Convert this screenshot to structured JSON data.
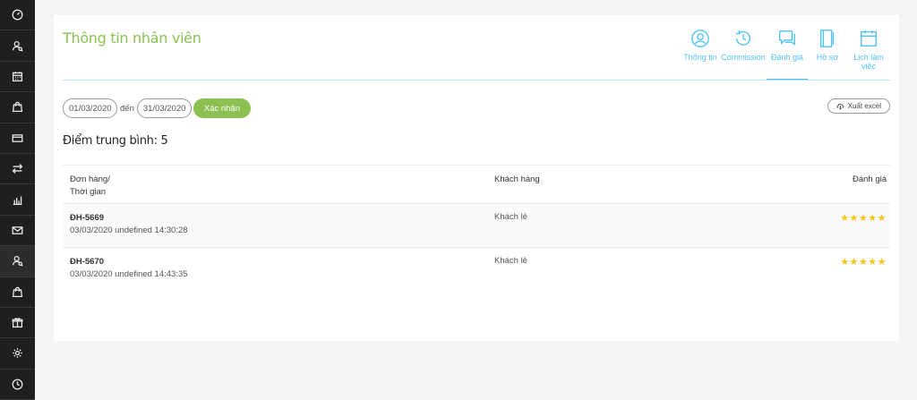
{
  "sidebar": {
    "items": [
      {
        "icon": "speedometer-icon"
      },
      {
        "icon": "user-search-icon"
      },
      {
        "icon": "calendar-icon"
      },
      {
        "icon": "shopping-bag-icon"
      },
      {
        "icon": "credit-card-icon"
      },
      {
        "icon": "transfer-icon"
      },
      {
        "icon": "bar-chart-icon"
      },
      {
        "icon": "mail-icon"
      },
      {
        "icon": "user-search-icon"
      },
      {
        "icon": "shopping-bag-icon"
      },
      {
        "icon": "gift-icon"
      },
      {
        "icon": "gear-icon"
      },
      {
        "icon": "clock-icon"
      }
    ],
    "active_index": 8
  },
  "header": {
    "title": "Thông tin nhân viên"
  },
  "tabs": [
    {
      "label": "Thông tin",
      "icon": "user-circle-icon"
    },
    {
      "label": "Commission",
      "icon": "history-icon"
    },
    {
      "label": "Đánh giá",
      "icon": "chat-icon",
      "active": true
    },
    {
      "label": "Hồ sơ",
      "icon": "notebook-icon"
    },
    {
      "label": "Lịch làm việc",
      "icon": "calendar-icon"
    }
  ],
  "filter": {
    "from_date": "01/03/2020",
    "separator": "đến",
    "to_date": "31/03/2020",
    "confirm_label": "Xác nhận"
  },
  "export_label": "Xuất excel",
  "average": "Điểm trung bình: 5",
  "table": {
    "headers": {
      "order_line1": "Đơn hàng/",
      "order_line2": "Thời gian",
      "customer": "Khách hàng",
      "rating": "Đánh giá"
    },
    "rows": [
      {
        "order": "ĐH-5669",
        "time": "03/03/2020 undefined 14:30:28",
        "customer": "Khách lẻ",
        "rating": 5,
        "stars": "★★★★★"
      },
      {
        "order": "ĐH-5670",
        "time": "03/03/2020 undefined 14:43:35",
        "customer": "Khách lẻ",
        "rating": 5,
        "stars": "★★★★★"
      }
    ]
  },
  "colors": {
    "accent_green": "#8cc152",
    "accent_blue": "#4fc3f7",
    "star": "#f5c518",
    "sidebar_bg": "#1f1f1f"
  }
}
